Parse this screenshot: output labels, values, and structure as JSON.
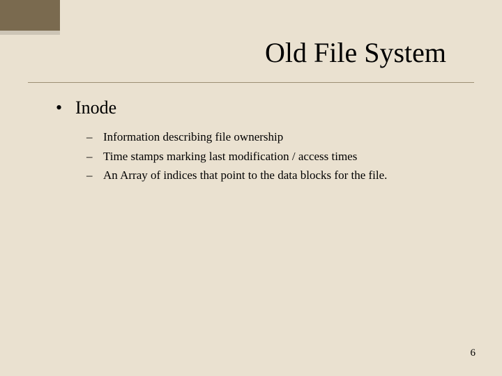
{
  "title": "Old File System",
  "main_bullet": "Inode",
  "sub_bullets": [
    "Information describing file ownership",
    "Time stamps marking last modification / access times",
    "An Array of indices that point to the data blocks for the file."
  ],
  "page_number": "6"
}
